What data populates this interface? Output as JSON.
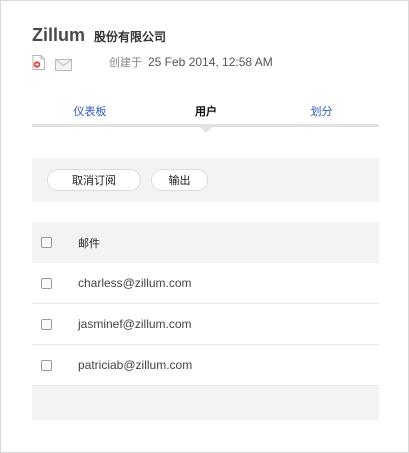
{
  "header": {
    "brand": "Zillum",
    "company": "股份有限公司",
    "created_label": "创建于",
    "created_value": "25 Feb 2014, 12:58 AM",
    "icons": [
      "pdf-icon",
      "mail-icon"
    ]
  },
  "tabs": [
    {
      "label": "仪表板",
      "active": false
    },
    {
      "label": "用户",
      "active": true
    },
    {
      "label": "划分",
      "active": false
    }
  ],
  "toolbar": {
    "unsubscribe_label": "取消订阅",
    "export_label": "输出"
  },
  "table": {
    "header": "邮件",
    "rows": [
      {
        "email": "charless@zillum.com",
        "checked": false
      },
      {
        "email": "jasminef@zillum.com",
        "checked": false
      },
      {
        "email": "patriciab@zillum.com",
        "checked": false
      }
    ]
  },
  "colors": {
    "link": "#2e5cb8",
    "panel": "#f3f3f3",
    "pdf_red": "#d9534f"
  }
}
